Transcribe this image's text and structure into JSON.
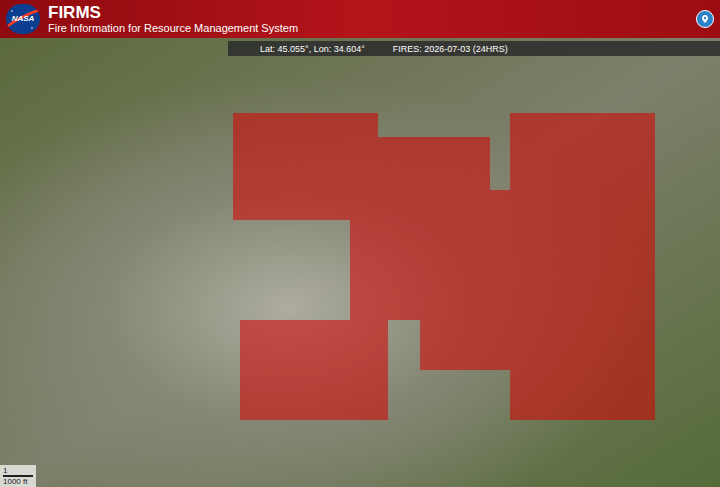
{
  "header": {
    "logo": "NASA",
    "title": "FIRMS",
    "subtitle": "Fire Information for Resource Management System"
  },
  "info_bar": {
    "coordinates": "Lat: 45.055°, Lon: 34.604°",
    "fires": "FIRES: 2026-07-03 (24HRS)"
  },
  "scale": {
    "upper": "1",
    "lower": "1000 ft"
  }
}
